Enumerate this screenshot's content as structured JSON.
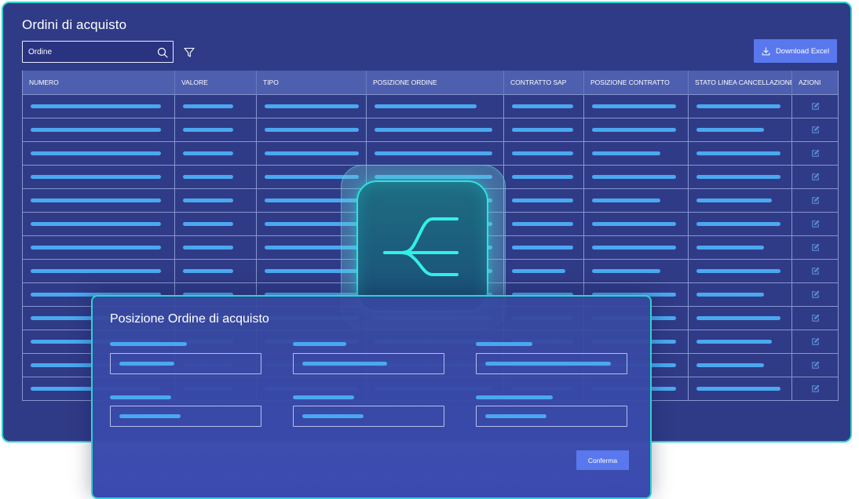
{
  "window": {
    "title": "Ordini di acquisto"
  },
  "search": {
    "value": "",
    "placeholder": "Ordine"
  },
  "toolbar": {
    "download_label": "Download Excel"
  },
  "table": {
    "columns": [
      "NUMERO",
      "VALORE",
      "TIPO",
      "POSIZIONE ORDINE",
      "CONTRATTO SAP",
      "POSIZIONE CONTRATTO",
      "STATO LINEA CANCELLAZIONE",
      "AZIONI"
    ],
    "row_count": 13,
    "placeholder_color": "#4aa8f0"
  },
  "modal": {
    "title": "Posizione Ordine di acquisto",
    "confirm_label": "Conferma"
  },
  "colors": {
    "background": "#303b87",
    "accent": "#5a78ee",
    "border_highlight": "#2ad4cf",
    "placeholder_bar": "#4aa8f0"
  },
  "icons": [
    "search-icon",
    "filter-icon",
    "download-icon",
    "edit-icon",
    "merge-icon"
  ]
}
